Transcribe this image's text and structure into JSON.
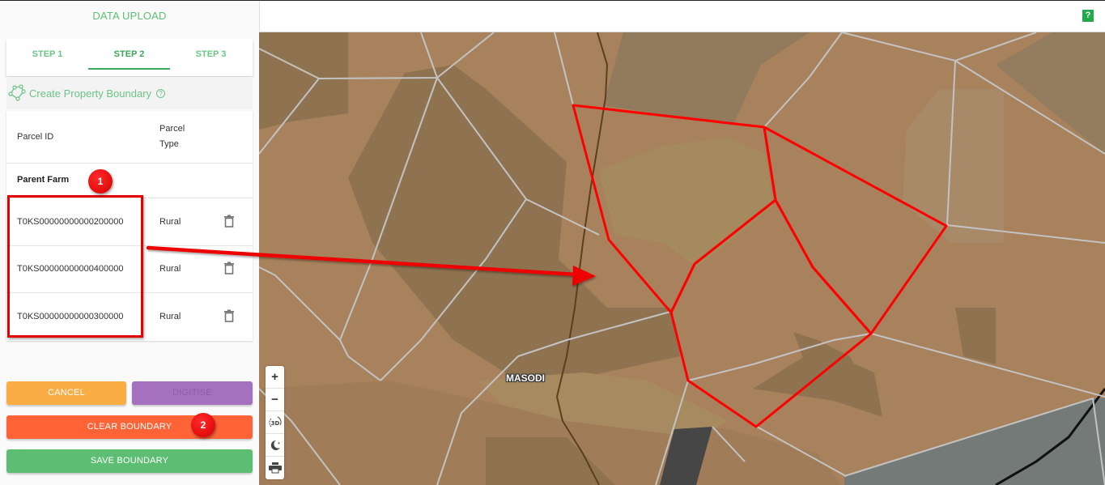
{
  "sidebar": {
    "title": "DATA UPLOAD",
    "tabs": [
      {
        "label": "STEP 1",
        "active": false
      },
      {
        "label": "STEP 2",
        "active": true
      },
      {
        "label": "STEP 3",
        "active": false
      }
    ],
    "section_title": "Create Property Boundary",
    "section_icon": "polygon-icon",
    "help_icon": "question-circle-icon",
    "table": {
      "headers": {
        "parcel_id": "Parcel ID",
        "parcel_type_line1": "Parcel",
        "parcel_type_line2": "Type"
      },
      "group_label": "Parent Farm",
      "rows": [
        {
          "parcel_id": "T0KS00000000000200000",
          "parcel_type": "Rural",
          "action_icon": "trash-icon"
        },
        {
          "parcel_id": "T0KS00000000000400000",
          "parcel_type": "Rural",
          "action_icon": "trash-icon"
        },
        {
          "parcel_id": "T0KS00000000000300000",
          "parcel_type": "Rural",
          "action_icon": "trash-icon"
        }
      ]
    },
    "buttons": {
      "cancel": "CANCEL",
      "digitise": "DIGITISE",
      "clear_boundary": "CLEAR BOUNDARY",
      "save_boundary": "SAVE BOUNDARY"
    }
  },
  "header": {
    "help_label": "?"
  },
  "map": {
    "place_label": "MASODI",
    "controls": [
      {
        "name": "zoom-in",
        "icon": "+"
      },
      {
        "name": "zoom-out",
        "icon": "−"
      },
      {
        "name": "3d-toggle",
        "icon": "3D"
      },
      {
        "name": "night-mode",
        "icon": "moon"
      },
      {
        "name": "print",
        "icon": "printer"
      }
    ]
  },
  "annotations": {
    "badges": [
      "1",
      "2"
    ]
  },
  "colors": {
    "accent_green": "#5cbf74",
    "active_tab": "#3aa75a",
    "cancel": "#fbad45",
    "digitise": "#a571be",
    "clear": "#ff6336",
    "save": "#5dbd73",
    "boundary_red": "#ff0000",
    "annotation_red": "#e40000"
  }
}
